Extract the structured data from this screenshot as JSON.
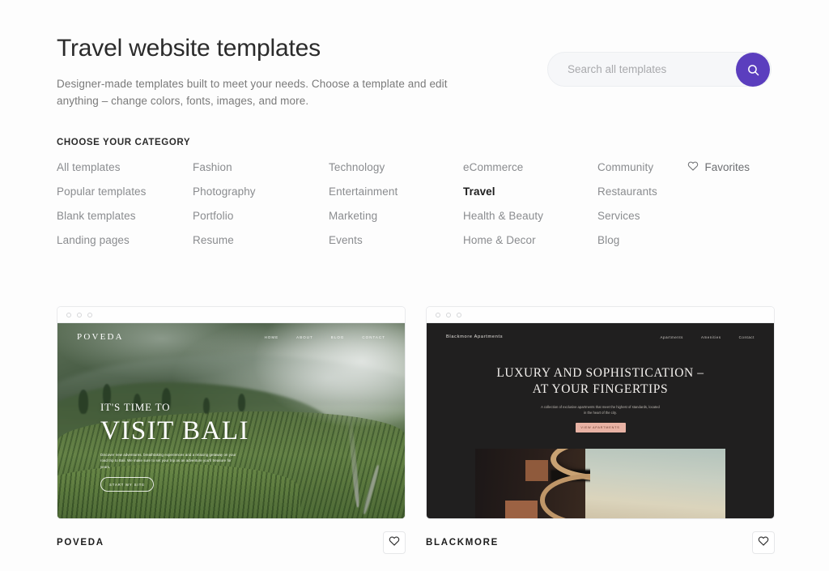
{
  "header": {
    "title": "Travel website templates",
    "subtitle": "Designer-made templates built to meet your needs. Choose a template and edit anything – change colors, fonts, images, and more."
  },
  "search": {
    "placeholder": "Search all templates",
    "value": "",
    "icon": "search-icon",
    "button_color": "#5B3EBE"
  },
  "categories": {
    "heading": "CHOOSE YOUR CATEGORY",
    "active": "Travel",
    "items": [
      "All templates",
      "Fashion",
      "Technology",
      "eCommerce",
      "Community",
      "Popular templates",
      "Photography",
      "Entertainment",
      "Travel",
      "Restaurants",
      "Blank templates",
      "Portfolio",
      "Marketing",
      "Health & Beauty",
      "Services",
      "Landing pages",
      "Resume",
      "Events",
      "Home & Decor",
      "Blog"
    ],
    "favorites": {
      "label": "Favorites",
      "icon": "heart-icon"
    }
  },
  "cards": [
    {
      "name": "POVEDA",
      "favorite_icon": "heart-icon",
      "chrome_dots": 3,
      "preview": {
        "logo": "POVEDA",
        "nav": [
          "HOME",
          "ABOUT",
          "BLOG",
          "CONTACT"
        ],
        "kicker": "IT'S TIME TO",
        "title": "VISIT BALI",
        "body": "Discover new adventures, breathtaking experiences and a relaxing getaway on your road trip to Bali. We make sure to set your trip as an adventure you'll treasure for years.",
        "cta": "START MY SITE"
      }
    },
    {
      "name": "BLACKMORE",
      "favorite_icon": "heart-icon",
      "chrome_dots": 3,
      "preview": {
        "logo": "Blackmore Apartments",
        "nav": [
          "Apartments",
          "Amenities",
          "Contact"
        ],
        "title_line1": "LUXURY AND SOPHISTICATION –",
        "title_line2": "AT YOUR FINGERTIPS",
        "body": "A collection of exclusive apartments that meet the highest of standards, located in the heart of the city.",
        "cta": "VIEW APARTMENTS"
      }
    }
  ]
}
